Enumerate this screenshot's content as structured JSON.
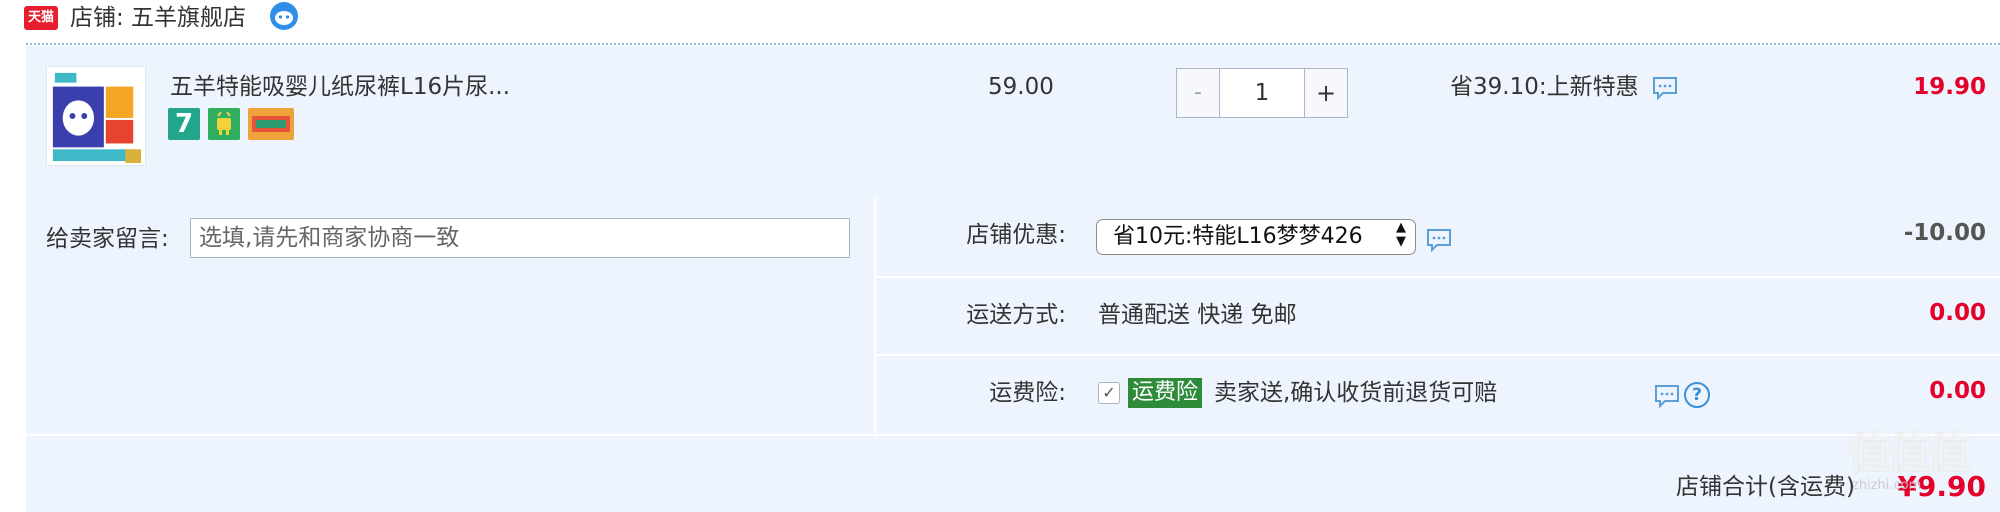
{
  "store": {
    "badge": "天猫",
    "label": "店铺: 五羊旗舰店",
    "wangwang_icon": "wangwang-chat-icon"
  },
  "product": {
    "title": "五羊特能吸婴儿纸尿裤L16片尿...",
    "unit_price": "59.00",
    "quantity": "1",
    "minus": "-",
    "plus": "+",
    "promo": "省39.10:上新特惠",
    "total": "19.90",
    "tags": [
      "7",
      "android-tag",
      "card-tag"
    ]
  },
  "memo": {
    "label": "给卖家留言:",
    "placeholder": "选填,请先和商家协商一致"
  },
  "options": {
    "coupon": {
      "label": "店铺优惠:",
      "selected": "省10元:特能L16梦梦426",
      "value": "-10.00"
    },
    "shipping": {
      "label": "运送方式:",
      "method": "普通配送 快递 免邮",
      "value": "0.00"
    },
    "insurance": {
      "label": "运费险:",
      "checked": "✓",
      "badge": "运费险",
      "desc": "卖家送,确认收货前退货可赔",
      "value": "0.00"
    }
  },
  "footer": {
    "label": "店铺合计(含运费)",
    "total": "¥9.90"
  },
  "watermark": {
    "logo": "值值值",
    "url": "zhizhi.com"
  },
  "colors": {
    "price_red": "#e4002b",
    "row_bg": "#eef4fd",
    "insurance_green": "#2e8b3a",
    "tmall_red": "#e61e2f"
  }
}
